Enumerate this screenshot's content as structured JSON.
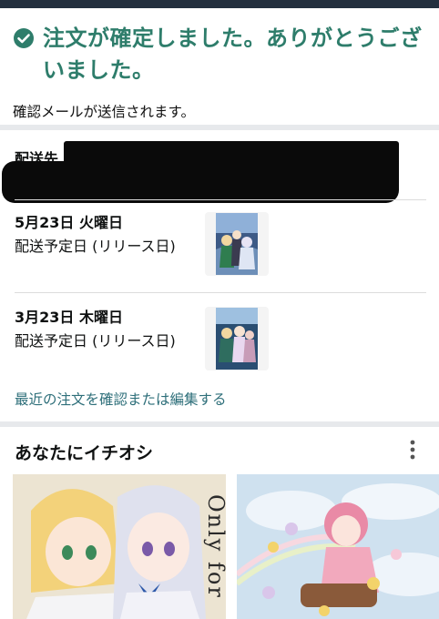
{
  "confirmation": {
    "title": "注文が確定しました。ありがとうございました。",
    "subtitle": "確認メールが送信されます。",
    "accent_color": "#2e7d6b",
    "icon": "check-circle-icon"
  },
  "shipping": {
    "address_label": "配送先"
  },
  "deliveries": [
    {
      "date": "5月23日 火曜日",
      "status": "配送予定日 (リリース日)"
    },
    {
      "date": "3月23日 木曜日",
      "status": "配送予定日 (リリース日)"
    }
  ],
  "orders_link": "最近の注文を確認または編集する",
  "recommendations": {
    "title": "あなたにイチオシ",
    "menu_icon": "kebab-menu-icon",
    "card1_text": "Only for"
  }
}
